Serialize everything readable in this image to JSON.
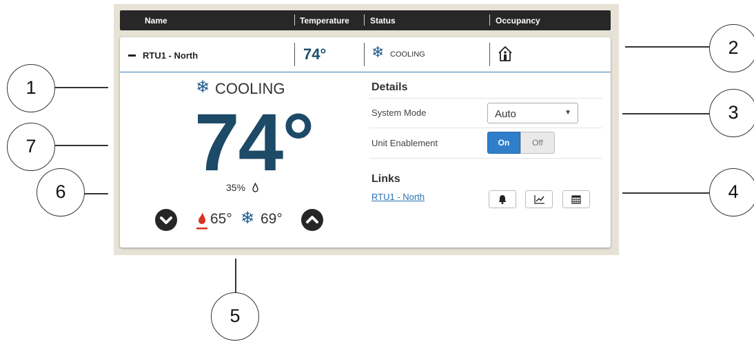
{
  "table_header": {
    "name": "Name",
    "temperature": "Temperature",
    "status": "Status",
    "occupancy": "Occupancy"
  },
  "unit_row": {
    "name": "RTU1 - North",
    "temperature": "74°",
    "status": "COOLING",
    "collapse_icon": "minus-icon",
    "status_icon": "snowflake-icon",
    "occupancy_icon": "occupied-home-icon"
  },
  "detail": {
    "status": "COOLING",
    "current_temp": "74°",
    "humidity": "35%",
    "heat_setpoint": "65°",
    "cool_setpoint": "69°",
    "details_title": "Details",
    "system_mode_label": "System Mode",
    "system_mode_value": "Auto",
    "unit_enablement_label": "Unit Enablement",
    "toggle_on": "On",
    "toggle_off": "Off",
    "toggle_state": "On",
    "links_title": "Links",
    "link_text": "RTU1 - North",
    "link_buttons": [
      "bell-icon",
      "trend-chart-icon",
      "calendar-icon"
    ]
  },
  "callouts": [
    "1",
    "2",
    "3",
    "4",
    "5",
    "6",
    "7"
  ],
  "colors": {
    "header_bg": "#272727",
    "accent_blue": "#2f7ec9",
    "temp_blue": "#1c4a67",
    "snow_blue": "#1d5b8c",
    "heat_red": "#d9341e",
    "link_blue": "#2a72b5"
  }
}
